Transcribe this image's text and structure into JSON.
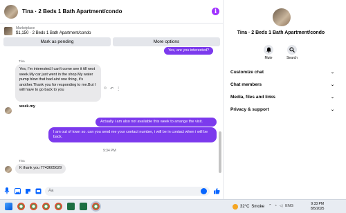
{
  "header": {
    "title": "Tina · 2 Beds 1 Bath Apartment/condo",
    "info_icon": "i"
  },
  "marketplace": {
    "label": "Marketplace",
    "item": "$1,150 · 2 Beds 1 Bath Apartment/condo"
  },
  "actions": {
    "pending_label": "Mark as pending",
    "more_label": "More options"
  },
  "messages": {
    "out_top": "Yes, are you interested?",
    "sender_1": "Tina",
    "in_1": "Yes, I'm interested.I can't come see it till next week.My car just went in the shop.My water pump blow that bad aint one thing, it's another.Thank you for responding to me.But I will have to go back to you",
    "in_1_tail": "week.my",
    "out_1": "Actually i am also not available this week to arrange the visit.",
    "out_2": "I am out of town so. can you send me your contact number, i will be in contact when i will be back.",
    "timestamp": "9:34 PM",
    "sender_2": "Tina",
    "in_2": "K thank you 7743605629"
  },
  "composer": {
    "placeholder": "Aa"
  },
  "panel": {
    "title": "Tina · 2 Beds 1 Bath Apartment/condo",
    "mute_label": "Mute",
    "search_label": "Search",
    "sections": [
      "Customize chat",
      "Chat members",
      "Media, files and links",
      "Privacy & support"
    ]
  },
  "taskbar": {
    "weather_temp": "32°C",
    "weather_text": "Smoke",
    "lang": "ENG",
    "time": "9:33 PM",
    "date": "8/5/2025"
  },
  "colors": {
    "accent": "#7c3aed",
    "link": "#0866ff",
    "bubble_in": "#e9e9eb"
  }
}
